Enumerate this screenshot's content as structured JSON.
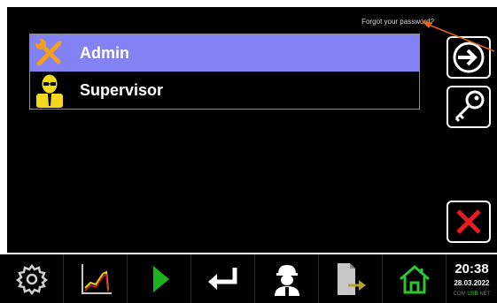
{
  "login": {
    "forgot_password": "Forgot your password?",
    "users": [
      {
        "label": "Admin",
        "icon": "wrench-screwdriver-icon",
        "selected": true
      },
      {
        "label": "Supervisor",
        "icon": "supervisor-person-icon",
        "selected": false
      }
    ],
    "buttons": {
      "login": "login-arrow-icon",
      "password": "key-icon",
      "cancel": "close-x-icon"
    }
  },
  "taskbar": {
    "items": [
      "gear-icon",
      "trend-chart-icon",
      "play-icon",
      "enter-return-icon",
      "operator-helmet-icon",
      "document-export-icon",
      "home-icon"
    ],
    "time": "20:38",
    "date": "28.03.2022",
    "status": {
      "com": "COM",
      "usb": "USB",
      "net": "NET"
    }
  },
  "colors": {
    "selected_row": "#8282f5",
    "accent_orange": "#f59f1a",
    "play_green": "#1db31d",
    "home_green": "#2fc52f",
    "cancel_red": "#e81c1c",
    "annotation_arrow": "#e8631a"
  }
}
